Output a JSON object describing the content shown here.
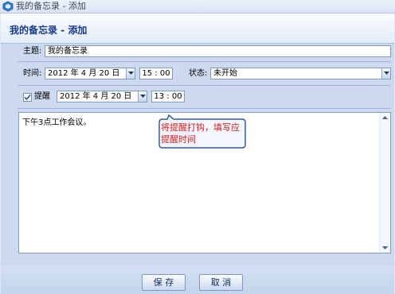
{
  "window": {
    "title": "我的备忘录 - 添加"
  },
  "header": {
    "title": "我的备忘录 - 添加"
  },
  "form": {
    "subject_label": "主题:",
    "subject_value": "我的备忘录",
    "time_label": "时间:",
    "time_date": "2012 年 4 月 20 日",
    "time_clock": "15 : 00",
    "status_label": "状态:",
    "status_value": "未开始",
    "reminder_label": "提醒",
    "reminder_checked": true,
    "reminder_date": "2012 年 4 月 20 日",
    "reminder_clock": "13 : 00",
    "memo_text": "下午3点工作会议。"
  },
  "callout": {
    "text": "将提醒打钩，填写应提醒时间"
  },
  "footer": {
    "save_label": "保 存",
    "cancel_label": "取 消"
  },
  "colors": {
    "title_blue": "#16398a",
    "callout_red": "#d41b1b",
    "panel_bg": "#ccd9ee"
  },
  "icons": [
    "app-icon",
    "dropdown-arrow-icon",
    "checkmark-icon",
    "scroll-up-icon",
    "scroll-down-icon"
  ]
}
